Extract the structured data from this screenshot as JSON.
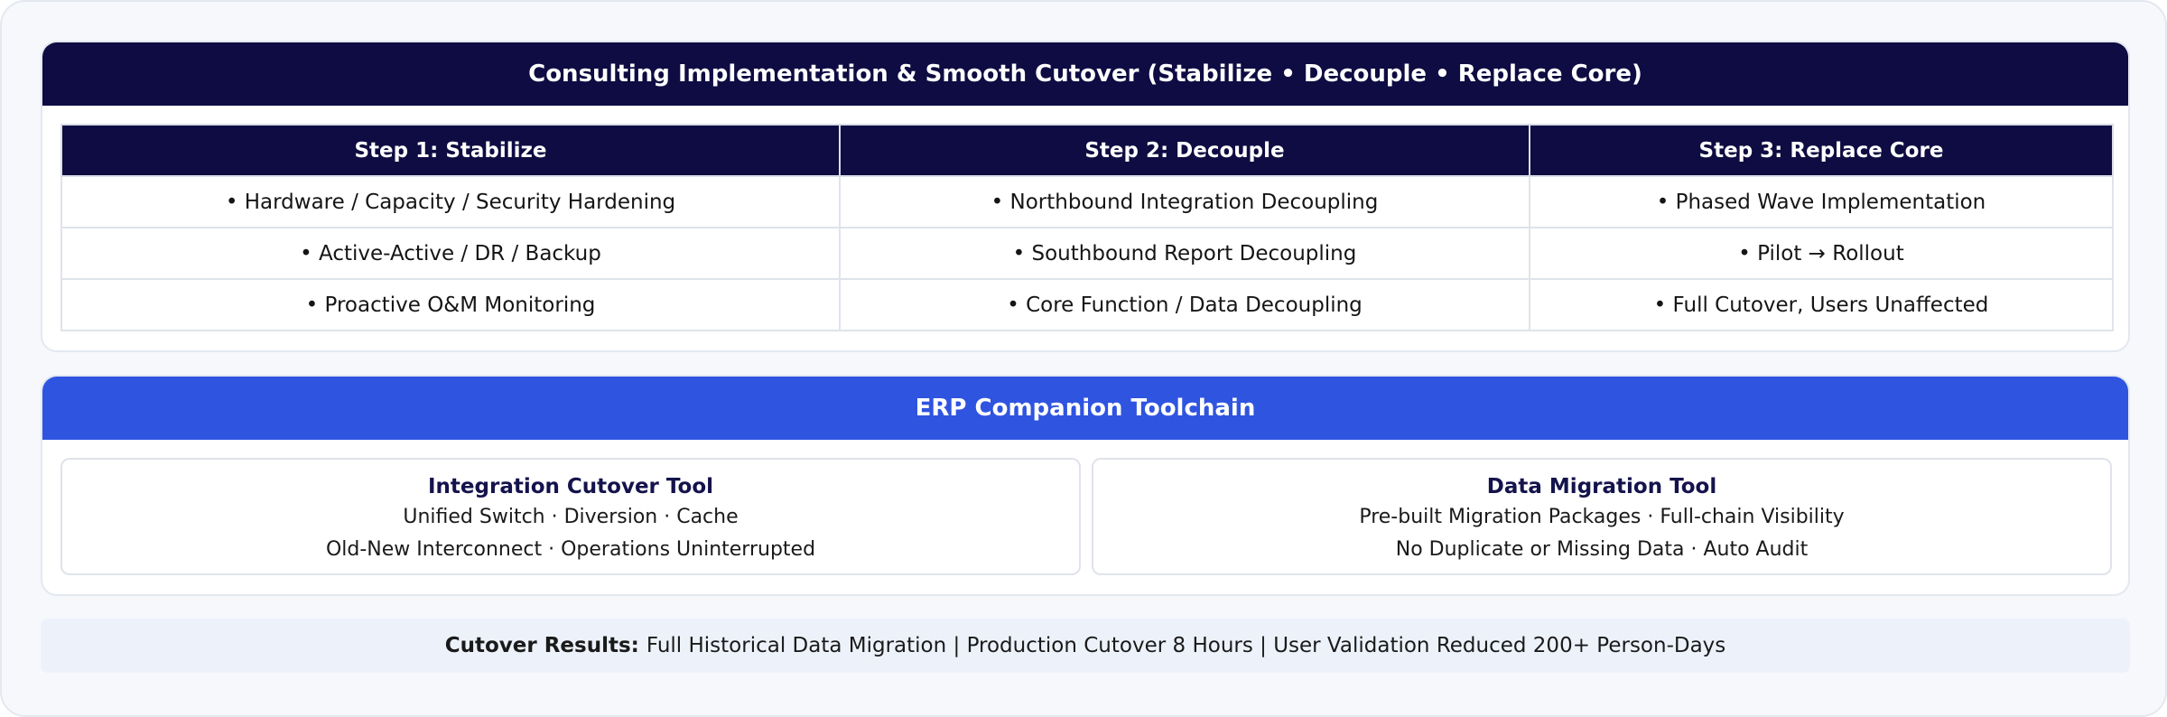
{
  "implementation": {
    "title": "Consulting Implementation & Smooth Cutover (Stabilize • Decouple • Replace Core)",
    "columns": [
      "Step 1: Stabilize",
      "Step 2: Decouple",
      "Step 3: Replace Core"
    ],
    "rows": [
      [
        "• Hardware / Capacity / Security Hardening",
        "• Northbound Integration Decoupling",
        "• Phased Wave Implementation"
      ],
      [
        "• Active-Active / DR / Backup",
        "• Southbound Report Decoupling",
        "• Pilot → Rollout"
      ],
      [
        "• Proactive O&M Monitoring",
        "• Core Function / Data Decoupling",
        "• Full Cutover, Users Unaffected"
      ]
    ]
  },
  "toolchain": {
    "title": "ERP Companion Toolchain",
    "tools": [
      {
        "name": "Integration Cutover Tool",
        "lines": [
          "Unified Switch · Diversion · Cache",
          "Old-New Interconnect · Operations Uninterrupted"
        ]
      },
      {
        "name": "Data Migration Tool",
        "lines": [
          "Pre-built Migration Packages · Full-chain Visibility",
          "No Duplicate or Missing Data · Auto Audit"
        ]
      }
    ]
  },
  "results": {
    "label": "Cutover Results:",
    "text": "Full Historical Data Migration | Production Cutover 8 Hours | User Validation Reduced 200+ Person-Days"
  },
  "colors": {
    "navy": "#0e0c42",
    "blue": "#2f54e0",
    "results_bg": "#edf2fa"
  }
}
